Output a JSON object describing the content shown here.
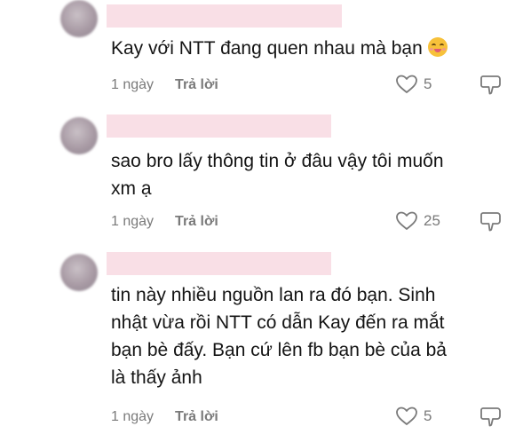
{
  "comments": [
    {
      "text_lines": [
        "Kay với NTT đang quen nhau mà bạn"
      ],
      "emoji": "smiling-face-icon",
      "time": "1 ngày",
      "reply_label": "Trả lời",
      "likes": "5"
    },
    {
      "text_lines": [
        "sao bro lấy thông tin ở đâu vậy tôi muốn",
        "xm ạ"
      ],
      "time": "1 ngày",
      "reply_label": "Trả lời",
      "likes": "25"
    },
    {
      "text_lines": [
        "tin này nhiều nguồn lan ra đó bạn. Sinh",
        "nhật vừa rồi NTT có dẫn Kay đến ra mắt",
        "bạn bè đấy. Bạn cứ lên fb bạn bè của bả",
        "là thấy ảnh"
      ],
      "time": "1 ngày",
      "reply_label": "Trả lời",
      "likes": "5"
    }
  ],
  "colors": {
    "redaction": "#f9dfe6",
    "text": "#141414",
    "meta": "#7a7a7a"
  }
}
